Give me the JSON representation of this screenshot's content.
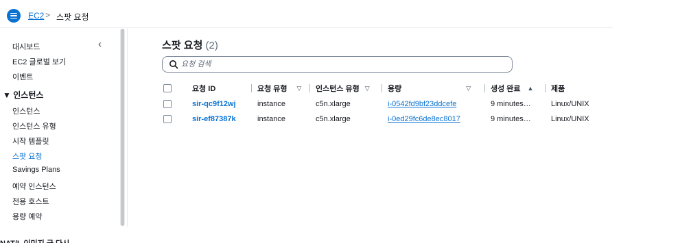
{
  "breadcrumb": {
    "root": "EC2",
    "separator": ">",
    "current": "스팟 요청"
  },
  "sidebar": {
    "top_items": [
      {
        "label": "대시보드"
      },
      {
        "label": "EC2 글로벌 보기"
      },
      {
        "label": "이벤트"
      }
    ],
    "section": {
      "label": "인스턴스",
      "toggle": "▼"
    },
    "section_items": [
      {
        "label": "인스턴스",
        "active": false
      },
      {
        "label": "인스턴스 유형",
        "active": false
      },
      {
        "label": "시작 템플릿",
        "active": false
      },
      {
        "label": "스팟 요청",
        "active": true
      },
      {
        "label": "Savings Plans",
        "active": false
      },
      {
        "label": "예약 인스턴스",
        "active": false
      },
      {
        "label": "전용 호스트",
        "active": false
      },
      {
        "label": "용량 예약",
        "active": false
      }
    ],
    "collapse_icon": "chevron-left-icon"
  },
  "main": {
    "title": "스팟 요청",
    "count": "(2)",
    "search_placeholder": "요청 검색",
    "columns": [
      {
        "label": "요청 ID",
        "sort": ""
      },
      {
        "label": "요청 유형",
        "sort": "▽"
      },
      {
        "label": "인스턴스 유형",
        "sort": "▽"
      },
      {
        "label": "용량",
        "sort": "▽"
      },
      {
        "label": "생성 완료",
        "sort": "▲"
      },
      {
        "label": "제품",
        "sort": ""
      }
    ],
    "rows": [
      {
        "request_id": "sir-qc9f12wj",
        "request_type": "instance",
        "instance_type": "c5n.xlarge",
        "capacity": "i-0542fd9bf23ddcefe",
        "created": "9 minutes…",
        "product": "Linux/UNIX"
      },
      {
        "request_id": "sir-ef87387k",
        "request_type": "instance",
        "instance_type": "c5n.xlarge",
        "capacity": "i-0ed29fc6de8ec8017",
        "created": "9 minutes…",
        "product": "Linux/UNIX"
      }
    ]
  },
  "footer_partial": "NAT/L 이미지 금 다시",
  "colors": {
    "accent": "#0972d3",
    "text": "#16191f",
    "muted": "#5f6b7a",
    "divider": "#e9ebed"
  }
}
